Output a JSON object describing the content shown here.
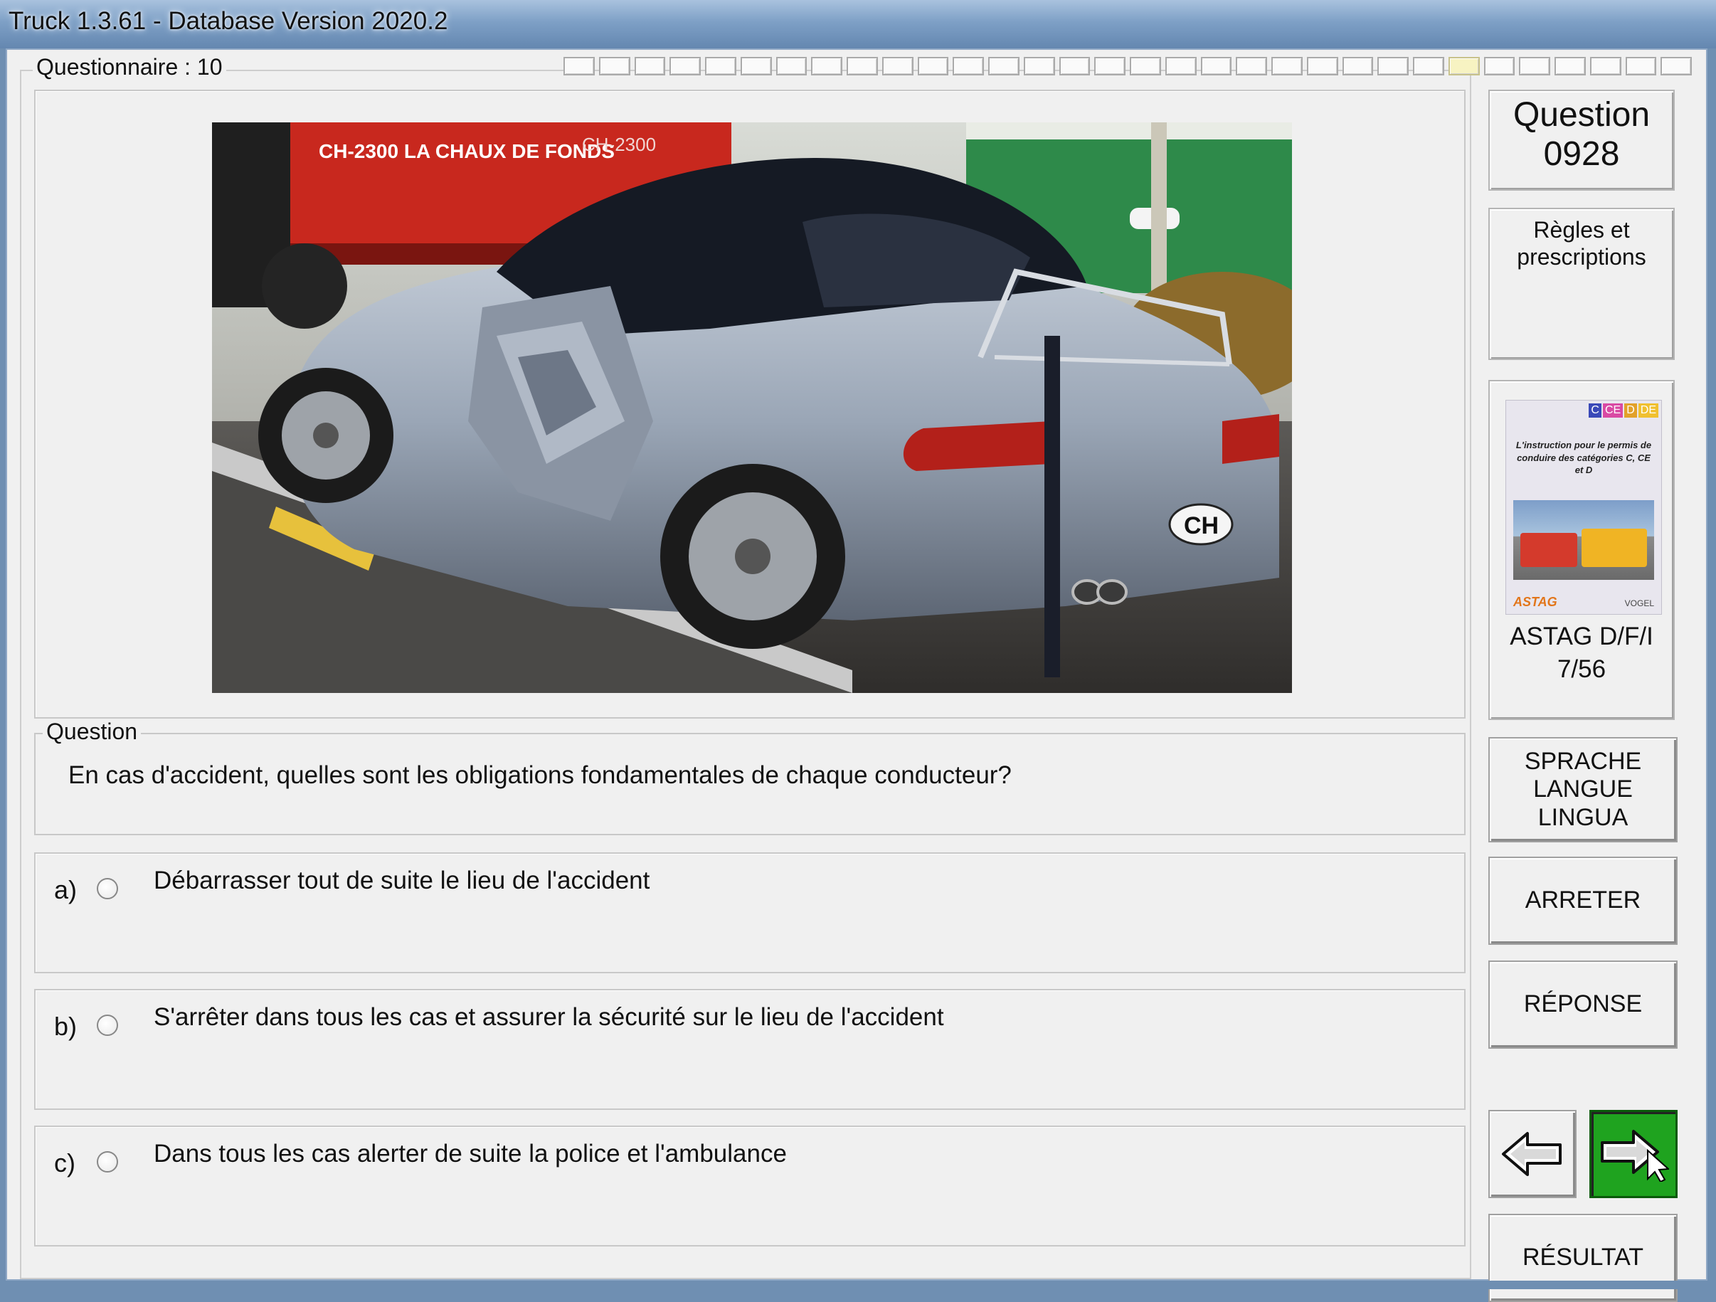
{
  "window": {
    "title": "Truck 1.3.61 - Database Version 2020.2"
  },
  "questionnaire": {
    "label": "Questionnaire : 10",
    "progress_total": 32,
    "progress_current": 25
  },
  "question": {
    "number_label": "Question",
    "number": "0928",
    "legend": "Question",
    "text": "En cas d'accident, quelles sont les obligations fondamentales de chaque conducteur?"
  },
  "answers": [
    {
      "letter": "a)",
      "text": "Débarrasser tout de suite le lieu de l'accident"
    },
    {
      "letter": "b)",
      "text": "S'arrêter dans tous les cas et assurer la sécurité sur le lieu de l'accident"
    },
    {
      "letter": "c)",
      "text": "Dans tous les cas alerter de suite la police et l'ambulance"
    }
  ],
  "sidebar": {
    "rules": "Règles et prescriptions",
    "book": {
      "badges": [
        "C",
        "CE",
        "D",
        "DE"
      ],
      "caption": "L'instruction pour le permis de conduire des catégories C, CE et D",
      "publisher_left": "ASTAG",
      "publisher_right": "VOGEL",
      "ref_line1": "ASTAG D/F/I",
      "ref_line2": "7/56"
    },
    "language_button": [
      "SPRACHE",
      "LANGUE",
      "LINGUA"
    ],
    "stop_button": "ARRETER",
    "answer_button": "RÉPONSE",
    "result_button": "RÉSULTAT"
  },
  "photo": {
    "truck_text_1": "CH-2300 LA CHAUX DE FONDS",
    "truck_text_2": "CH-2300",
    "plate": "CH"
  },
  "colors": {
    "next_button": "#1fa31f",
    "titlebar": "#7ea0c6"
  }
}
